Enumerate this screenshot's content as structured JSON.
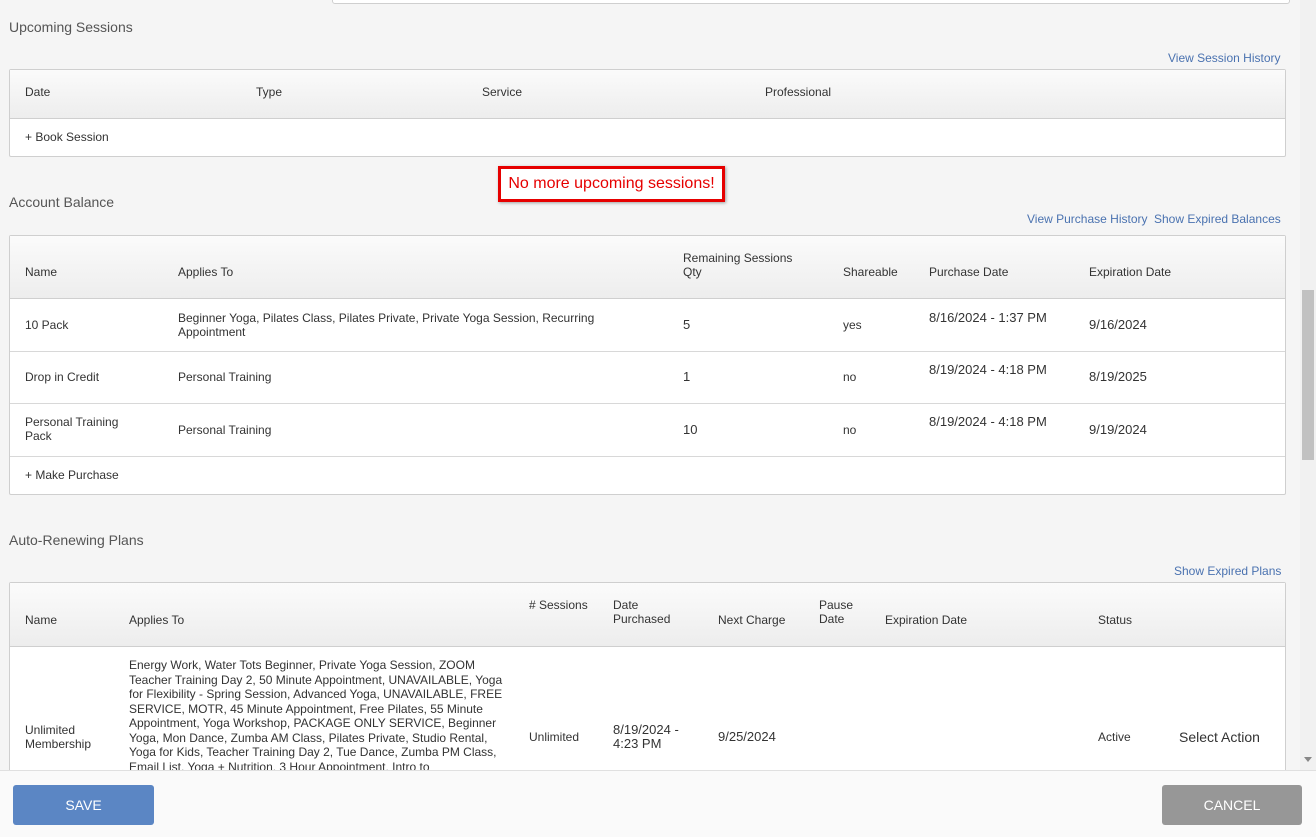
{
  "alert": "No more upcoming sessions!",
  "upcoming": {
    "title": "Upcoming Sessions",
    "history_link": "View Session History",
    "headers": [
      "Date",
      "Type",
      "Service",
      "Professional"
    ],
    "book_link": "+ Book Session"
  },
  "balance": {
    "title": "Account Balance",
    "purchase_history_link": "View Purchase History",
    "expired_link": "Show Expired Balances",
    "headers": {
      "name": "Name",
      "applies": "Applies To",
      "remaining": "Remaining Sessions Qty",
      "shareable": "Shareable",
      "purchase_date": "Purchase Date",
      "expiration": "Expiration Date"
    },
    "rows": [
      {
        "name": "10 Pack",
        "applies": "Beginner Yoga, Pilates Class, Pilates Private, Private Yoga Session, Recurring Appointment",
        "qty": "5",
        "shareable": "yes",
        "purchase": "8/16/2024 - 1:37 PM",
        "expiration": "9/16/2024"
      },
      {
        "name": "Drop in Credit",
        "applies": "Personal Training",
        "qty": "1",
        "shareable": "no",
        "purchase": "8/19/2024 - 4:18 PM",
        "expiration": "8/19/2025"
      },
      {
        "name": "Personal Training Pack",
        "applies": "Personal Training",
        "qty": "10",
        "shareable": "no",
        "purchase": "8/19/2024 - 4:18 PM",
        "expiration": "9/19/2024"
      }
    ],
    "make_purchase_link": "+ Make Purchase"
  },
  "plans": {
    "title": "Auto-Renewing Plans",
    "expired_link": "Show Expired Plans",
    "headers": {
      "name": "Name",
      "applies": "Applies To",
      "sessions": "# Sessions",
      "date_purchased": "Date Purchased",
      "next_charge": "Next Charge",
      "pause_date": "Pause Date",
      "expiration": "Expiration Date",
      "status": "Status"
    },
    "rows": [
      {
        "name": "Unlimited Membership",
        "applies": "Energy Work, Water Tots Beginner, Private Yoga Session, ZOOM Teacher Training Day 2, 50 Minute Appointment, UNAVAILABLE, Yoga for Flexibility - Spring Session, Advanced Yoga, UNAVAILABLE, FREE SERVICE, MOTR, 45 Minute Appointment, Free Pilates, 55 Minute Appointment, Yoga Workshop, PACKAGE ONLY SERVICE, Beginner Yoga, Mon Dance, Zumba AM Class, Pilates Private, Studio Rental, Yoga for Kids, Teacher Training Day 2, Tue Dance, Zumba PM Class, Email List, Yoga + Nutrition, 3 Hour Appointment, Intro to",
        "sessions": "Unlimited",
        "date_purchased": "8/19/2024 - 4:23 PM",
        "next_charge": "9/25/2024",
        "pause_date": "",
        "expiration": "",
        "status": "Active",
        "action": "Select Action"
      }
    ]
  },
  "footer": {
    "save": "SAVE",
    "cancel": "CANCEL"
  }
}
